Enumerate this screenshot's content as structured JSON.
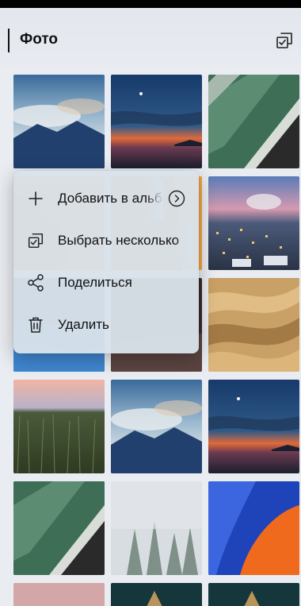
{
  "header": {
    "title": "Фото"
  },
  "menu": {
    "items": [
      {
        "label": "Добавить в альбом",
        "icon": "plus-icon"
      },
      {
        "label": "Выбрать несколько",
        "icon": "select-multiple-icon"
      },
      {
        "label": "Поделиться",
        "icon": "share-icon"
      },
      {
        "label": "Удалить",
        "icon": "trash-icon"
      }
    ]
  },
  "photos": [
    {
      "subject": "mountain-clouds"
    },
    {
      "subject": "sunset-sea"
    },
    {
      "subject": "aerial-waves"
    },
    {
      "subject": "orange-abstract"
    },
    {
      "subject": "dusk-city"
    },
    {
      "subject": "blue-waves"
    },
    {
      "subject": "dark-abstract"
    },
    {
      "subject": "sand-dunes"
    },
    {
      "subject": "grass-field"
    },
    {
      "subject": "mountain-clouds"
    },
    {
      "subject": "sunset-sea"
    },
    {
      "subject": "aerial-waves"
    },
    {
      "subject": "snowy-forest"
    },
    {
      "subject": "orange-blue-abstract"
    }
  ]
}
